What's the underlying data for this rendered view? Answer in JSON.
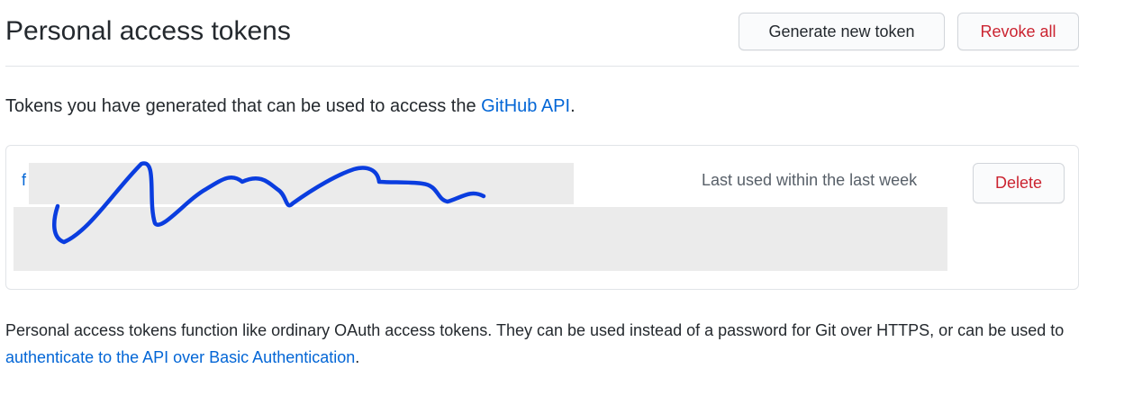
{
  "header": {
    "title": "Personal access tokens",
    "generate_label": "Generate new token",
    "revoke_all_label": "Revoke all"
  },
  "intro": {
    "text": "Tokens you have generated that can be used to access the ",
    "link": "GitHub API",
    "suffix": "."
  },
  "token": {
    "visible_prefix": "f",
    "last_used": "Last used within the last week",
    "delete_label": "Delete",
    "redaction_color": "#ebebeb",
    "scribble_color": "#0a3ddf"
  },
  "footnote": {
    "text": "Personal access tokens function like ordinary OAuth access tokens. They can be used instead of a password for Git over HTTPS, or can be used to ",
    "link": "authenticate to the API over Basic Authentication",
    "suffix": "."
  },
  "colors": {
    "link": "#0366d6",
    "danger": "#cb2431",
    "border": "#e1e4e8"
  }
}
